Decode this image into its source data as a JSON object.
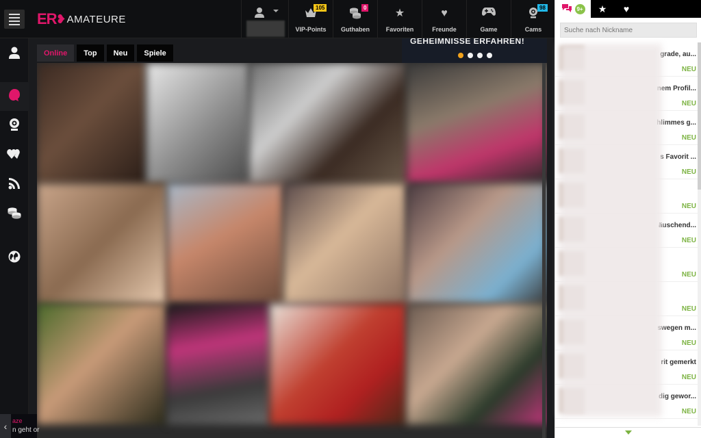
{
  "header": {
    "logo_ero": "ER",
    "logo_amateure": "AMATEURE",
    "nav": [
      {
        "label": "VIP-Points",
        "icon": "crown-icon",
        "badge": "105",
        "badge_color": "#f5c518"
      },
      {
        "label": "Guthaben",
        "icon": "coins-icon",
        "badge": "0",
        "badge_color": "#e0176a"
      },
      {
        "label": "Favoriten",
        "icon": "star-icon",
        "badge": "",
        "badge_color": ""
      },
      {
        "label": "Freunde",
        "icon": "heart-icon",
        "badge": "",
        "badge_color": ""
      },
      {
        "label": "Game",
        "icon": "gamepad-icon",
        "badge": "",
        "badge_color": ""
      },
      {
        "label": "Cams",
        "icon": "webcam-icon",
        "badge": "98",
        "badge_color": "#21b8e8"
      }
    ]
  },
  "sidebar": {
    "items": [
      {
        "icon": "user-icon"
      },
      {
        "icon": "profile-pink-icon"
      },
      {
        "icon": "webcam-icon"
      },
      {
        "icon": "hearts-icon"
      },
      {
        "icon": "rss-icon"
      },
      {
        "icon": "coins-icon"
      },
      {
        "icon": "globe-icon"
      }
    ]
  },
  "tabs": [
    "Online",
    "Top",
    "Neu",
    "Spiele"
  ],
  "banner": {
    "text": "GEHEIMNISSE ERFAHREN!"
  },
  "bottom_left": {
    "line1": "aze",
    "line2": "n geht or"
  },
  "chat": {
    "tab_badge": "9+",
    "search_placeholder": "Suche nach Nickname",
    "items": [
      {
        "snippet": "grade, au...",
        "status": "NEU"
      },
      {
        "snippet": "nem Profil...",
        "status": "NEU"
      },
      {
        "snippet": "hlimmes g...",
        "status": "NEU"
      },
      {
        "snippet": "s Favorit ...",
        "status": "NEU"
      },
      {
        "snippet": "",
        "status": "NEU"
      },
      {
        "snippet": "äuschend...",
        "status": "NEU"
      },
      {
        "snippet": "",
        "status": "NEU"
      },
      {
        "snippet": "",
        "status": "NEU"
      },
      {
        "snippet": "swegen m...",
        "status": "NEU"
      },
      {
        "snippet": "rit gemerkt",
        "status": "NEU"
      },
      {
        "snippet": "dig gewor...",
        "status": "NEU"
      }
    ]
  },
  "colors": {
    "brand_pink": "#e0176a",
    "new_green": "#7cb342",
    "active_dot": "#f2a21c"
  }
}
